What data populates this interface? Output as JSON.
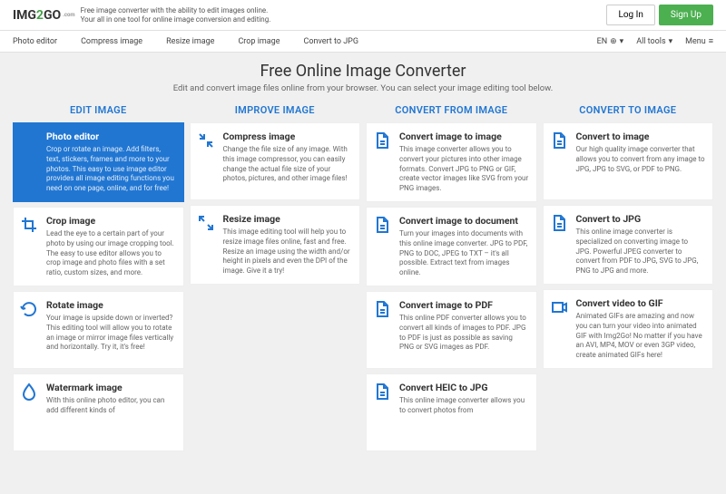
{
  "header": {
    "logo_img": "IMG",
    "logo_2": "2",
    "logo_go": "GO",
    "logo_sub": ".com",
    "tagline_line1": "Free image converter with the ability to edit images online.",
    "tagline_line2": "Your all in one tool for online image conversion and editing.",
    "login": "Log In",
    "signup": "Sign Up"
  },
  "subnav": {
    "items": [
      "Photo editor",
      "Compress image",
      "Resize image",
      "Crop image",
      "Convert to JPG"
    ],
    "lang": "EN",
    "alltools": "All tools",
    "menu": "Menu"
  },
  "hero": {
    "title": "Free Online Image Converter",
    "sub": "Edit and convert image files online from your browser. You can select your image editing tool below."
  },
  "columns": [
    {
      "title": "EDIT IMAGE",
      "cards": [
        {
          "icon": "pencil",
          "title": "Photo editor",
          "desc": "Crop or rotate an image. Add filters, text, stickers, frames and more to your photos. This easy to use image editor provides all image editing functions you need on one page, online, and for free!",
          "active": true
        },
        {
          "icon": "crop",
          "title": "Crop image",
          "desc": "Lead the eye to a certain part of your photo by using our image cropping tool. The easy to use editor allows you to crop image and photo files with a set ratio, custom sizes, and more."
        },
        {
          "icon": "rotate",
          "title": "Rotate image",
          "desc": "Your image is upside down or inverted? This editing tool will allow you to rotate an image or mirror image files vertically and horizontally. Try it, it's free!"
        },
        {
          "icon": "drop",
          "title": "Watermark image",
          "desc": "With this online photo editor, you can add different kinds of"
        }
      ]
    },
    {
      "title": "IMPROVE IMAGE",
      "cards": [
        {
          "icon": "compress",
          "title": "Compress image",
          "desc": "Change the file size of any image. With this image compressor, you can easily change the actual file size of your photos, pictures, and other image files!"
        },
        {
          "icon": "expand",
          "title": "Resize image",
          "desc": "This image editing tool will help you to resize image files online, fast and free. Resize an image using the width and/or height in pixels and even the DPI of the image. Give it a try!"
        }
      ]
    },
    {
      "title": "CONVERT FROM IMAGE",
      "cards": [
        {
          "icon": "file",
          "title": "Convert image to image",
          "desc": "This image converter allows you to convert your pictures into other image formats. Convert JPG to PNG or GIF, create vector images like SVG from your PNG images."
        },
        {
          "icon": "file",
          "title": "Convert image to document",
          "desc": "Turn your images into documents with this online image converter. JPG to PDF, PNG to DOC, JPEG to TXT – it's all possible. Extract text from images online."
        },
        {
          "icon": "file",
          "title": "Convert image to PDF",
          "desc": "This online PDF converter allows you to convert all kinds of images to PDF. JPG to PDF is just as possible as saving PNG or SVG images as PDF."
        },
        {
          "icon": "file",
          "title": "Convert HEIC to JPG",
          "desc": "This online image converter allows you to convert photos from"
        }
      ]
    },
    {
      "title": "CONVERT TO IMAGE",
      "cards": [
        {
          "icon": "file",
          "title": "Convert to image",
          "desc": "Our high quality image converter that allows you to convert from any image to JPG, JPG to SVG, or PDF to PNG."
        },
        {
          "icon": "file",
          "title": "Convert to JPG",
          "desc": "This online image converter is specialized on converting image to JPG. Powerful JPEG converter to convert from PDF to JPG, SVG to JPG, PNG to JPG and more."
        },
        {
          "icon": "video",
          "title": "Convert video to GIF",
          "desc": "Animated GIFs are amazing and now you can turn your video into animated GIF with Img2Go! No matter if you have an AVI, MP4, MOV or even 3GP video, create animated GIFs here!"
        }
      ]
    }
  ]
}
